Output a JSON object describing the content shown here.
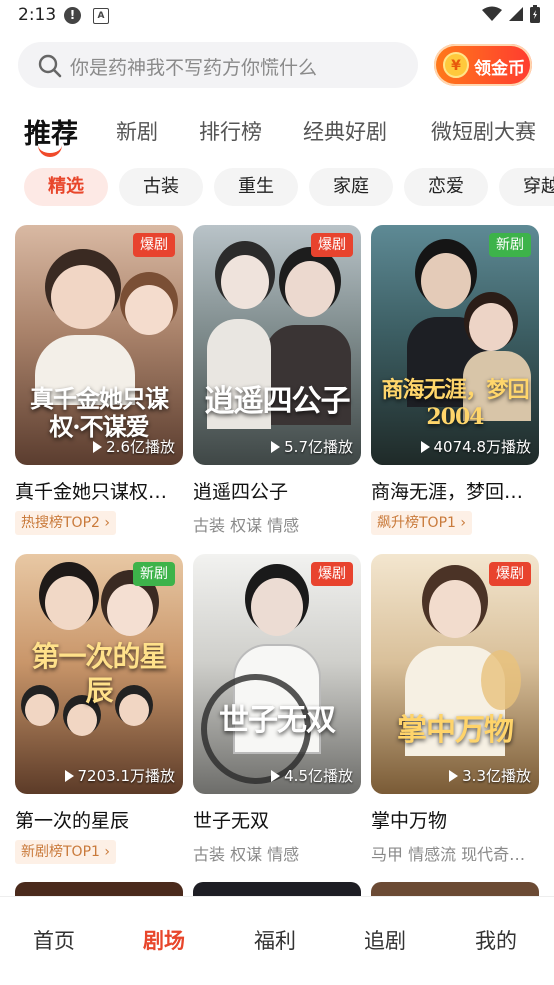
{
  "status_bar": {
    "time": "2:13",
    "notice_glyph": "!",
    "a_glyph": "A"
  },
  "search": {
    "placeholder": "你是药神我不写药方你慌什么"
  },
  "gold_button": {
    "label": "领金币",
    "coin_glyph": "¥"
  },
  "tabs": [
    "推荐",
    "新剧",
    "排行榜",
    "经典好剧",
    "微短剧大赛"
  ],
  "chips": [
    "精选",
    "古装",
    "重生",
    "家庭",
    "恋爱",
    "穿越"
  ],
  "cards": [
    {
      "title": "真千金她只谋权…",
      "badge": "爆剧",
      "plays": "2.6亿播放",
      "poster_text": "真千金她只谋权·不谋爱",
      "tag": "热搜榜TOP2",
      "genres": ""
    },
    {
      "title": "逍遥四公子",
      "badge": "爆剧",
      "plays": "5.7亿播放",
      "poster_text": "逍遥四公子",
      "tag": "",
      "genres": "古装 权谋 情感"
    },
    {
      "title": "商海无涯，梦回…",
      "badge": "新剧",
      "plays": "4074.8万播放",
      "poster_text": "商海无涯，梦回2004",
      "tag": "飙升榜TOP1",
      "genres": ""
    },
    {
      "title": "第一次的星辰",
      "badge": "新剧",
      "plays": "7203.1万播放",
      "poster_text": "第一次的星辰",
      "tag": "新剧榜TOP1",
      "genres": ""
    },
    {
      "title": "世子无双",
      "badge": "爆剧",
      "plays": "4.5亿播放",
      "poster_text": "世子无双",
      "tag": "",
      "genres": "古装 权谋 情感"
    },
    {
      "title": "掌中万物",
      "badge": "爆剧",
      "plays": "3.3亿播放",
      "poster_text": "掌中万物",
      "tag": "",
      "genres": "马甲 情感流 现代奇…"
    }
  ],
  "bottom_nav": [
    "首页",
    "剧场",
    "福利",
    "追剧",
    "我的"
  ],
  "colors": {
    "accent": "#e8462b",
    "hot_badge": "#e8432e",
    "new_badge": "#3db34a"
  }
}
